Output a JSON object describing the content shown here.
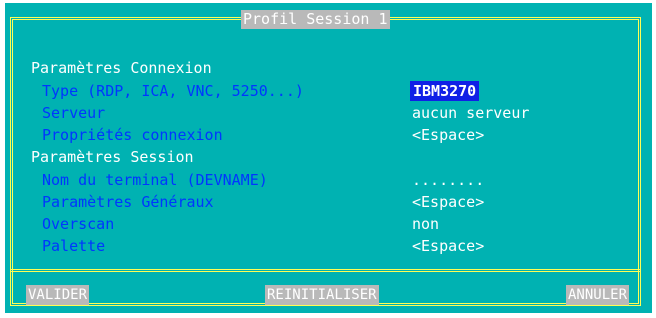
{
  "dialog": {
    "title": "Profil Session 1"
  },
  "connexion": {
    "heading": "Paramètres Connexion",
    "rows": [
      {
        "label": "Type (RDP, ICA, VNC, 5250...)",
        "value": "IBM3270"
      },
      {
        "label": "Serveur",
        "value": "aucun serveur"
      },
      {
        "label": "Propriétés connexion",
        "value": "<Espace>"
      }
    ]
  },
  "session": {
    "heading": "Paramètres Session",
    "rows": [
      {
        "label": "Nom du terminal (DEVNAME)",
        "value": "........"
      },
      {
        "label": "Paramètres Généraux",
        "value": "<Espace>"
      },
      {
        "label": "Overscan",
        "value": "non"
      },
      {
        "label": "Palette",
        "value": "<Espace>"
      }
    ]
  },
  "buttons": {
    "validate": "VALIDER",
    "reset": "REINITIALISER",
    "cancel": "ANNULER"
  },
  "colors": {
    "background": "#00b2b2",
    "label": "#0036ff",
    "border": "#ffff55",
    "selection": "#1020e6",
    "key": "#b9b9b9"
  }
}
